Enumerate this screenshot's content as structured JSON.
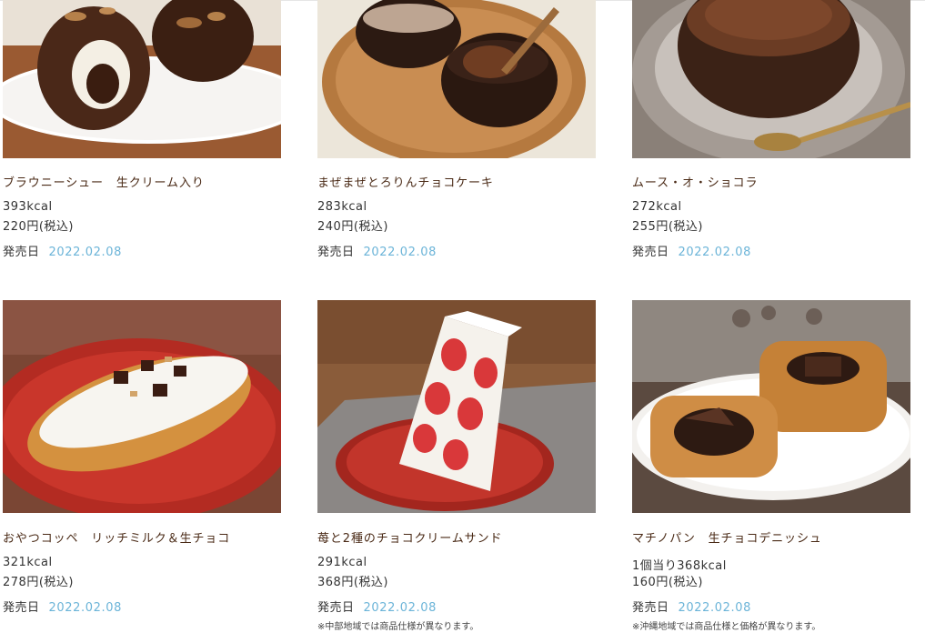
{
  "release_label": "発売日",
  "products": [
    {
      "name": "ブラウニーシュー　生クリーム入り",
      "kcal": "393kcal",
      "price": "220円(税込)",
      "release_date": "2022.02.08",
      "note": "",
      "image": "brownie-choux-cream-puff-photo"
    },
    {
      "name": "まぜまぜとろりんチョコケーキ",
      "kcal": "283kcal",
      "price": "240円(税込)",
      "release_date": "2022.02.08",
      "note": "",
      "image": "chocolate-cake-cups-on-wooden-plate-photo"
    },
    {
      "name": "ムース・オ・ショコラ",
      "kcal": "272kcal",
      "price": "255円(税込)",
      "release_date": "2022.02.08",
      "note": "",
      "image": "chocolate-mousse-cup-with-spoon-photo"
    },
    {
      "name": "おやつコッペ　リッチミルク＆生チョコ",
      "kcal": "321kcal",
      "price": "278円(税込)",
      "release_date": "2022.02.08",
      "note": "",
      "image": "koppe-bread-with-cream-on-red-plate-photo"
    },
    {
      "name": "苺と2種のチョコクリームサンド",
      "kcal": "291kcal",
      "price": "368円(税込)",
      "release_date": "2022.02.08",
      "note": "※中部地域では商品仕様が異なります。",
      "image": "strawberry-cream-sandwich-photo"
    },
    {
      "name": "マチノパン　生チョコデニッシュ",
      "kcal": "1個当り368kcal",
      "price": "160円(税込)",
      "release_date": "2022.02.08",
      "note": "※沖縄地域では商品仕様と価格が異なります。",
      "image": "chocolate-danish-pastry-photo"
    }
  ],
  "colors": {
    "product_name": "#4a2a16",
    "release_date": "#6bb4d8",
    "text": "#333333"
  }
}
